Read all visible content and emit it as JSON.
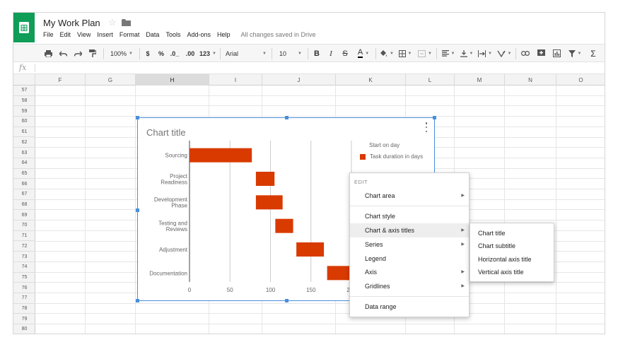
{
  "app": {
    "title": "My Work Plan",
    "save_status": "All changes saved in Drive",
    "menu": [
      "File",
      "Edit",
      "View",
      "Insert",
      "Format",
      "Data",
      "Tools",
      "Add-ons",
      "Help"
    ]
  },
  "toolbar": {
    "zoom": "100%",
    "currency": "$",
    "percent": "%",
    "decrease_decimals": ".0_",
    "increase_decimals": ".00",
    "number_format": "123",
    "font": "Arial",
    "font_size": "10",
    "bold": "B",
    "italic": "I",
    "strikethrough": "S",
    "text_color": "A"
  },
  "formula_bar": {
    "fx_label": "fx",
    "value": ""
  },
  "sheet": {
    "columns": [
      "F",
      "G",
      "H",
      "I",
      "J",
      "K",
      "L",
      "M",
      "N",
      "O"
    ],
    "selected_column": "H",
    "rows": [
      "57",
      "58",
      "59",
      "60",
      "61",
      "62",
      "63",
      "64",
      "65",
      "66",
      "67",
      "68",
      "69",
      "70",
      "71",
      "72",
      "73",
      "74",
      "75",
      "76",
      "77",
      "78",
      "79",
      "80"
    ]
  },
  "chart_data": {
    "type": "bar",
    "title": "Chart title",
    "orientation": "horizontal",
    "stacked": true,
    "categories": [
      [
        "Sourcing"
      ],
      [
        "Project",
        "Readiness"
      ],
      [
        "Development",
        "Phase"
      ],
      [
        "Testing and",
        "Reviews"
      ],
      [
        "Adjustment"
      ],
      [
        "Documentation"
      ]
    ],
    "series": [
      {
        "name": "Start on day",
        "values": [
          0,
          82,
          82,
          106,
          132,
          170
        ],
        "visible": false
      },
      {
        "name": "Task duration in days",
        "values": [
          77,
          23,
          33,
          22,
          34,
          30
        ],
        "color": "#d83a00"
      }
    ],
    "xticks": [
      "0",
      "50",
      "100",
      "150",
      "200"
    ],
    "xlim": [
      0,
      200
    ],
    "grid": true,
    "legend": "right"
  },
  "context_menu": {
    "header": "EDIT",
    "items": [
      {
        "label": "Chart area",
        "submenu": true
      },
      {
        "label": "Chart style",
        "submenu": false
      },
      {
        "label": "Chart & axis titles",
        "submenu": true,
        "active": true
      },
      {
        "label": "Series",
        "submenu": true
      },
      {
        "label": "Legend",
        "submenu": false
      },
      {
        "label": "Axis",
        "submenu": true
      },
      {
        "label": "Gridlines",
        "submenu": true
      },
      {
        "label": "Data range",
        "submenu": false
      }
    ],
    "submenu": [
      "Chart title",
      "Chart subtitle",
      "Horizontal axis title",
      "Vertical axis title"
    ]
  },
  "colors": {
    "brand": "#0f9d58",
    "bar": "#d83a00",
    "selection": "#4a8fdc"
  }
}
